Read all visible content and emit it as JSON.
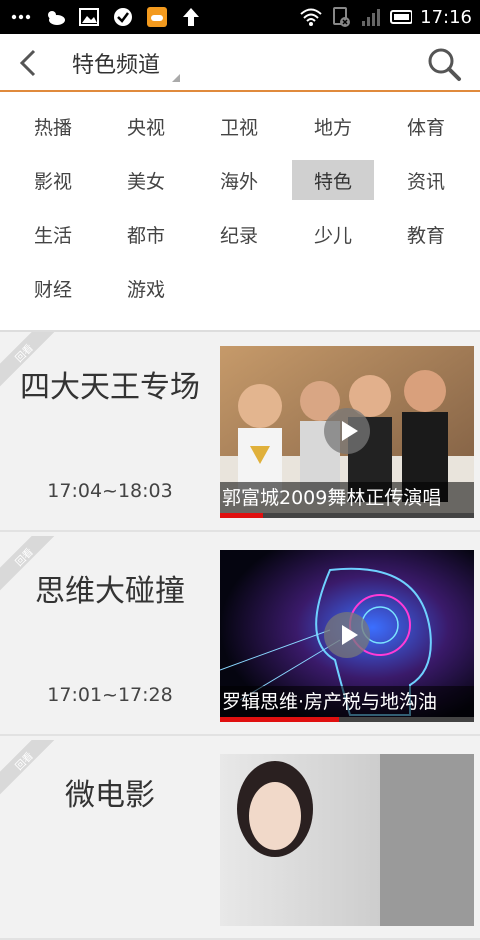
{
  "statusbar": {
    "time": "17:16",
    "left_icons": [
      "more-icon",
      "weather-icon",
      "gallery-icon",
      "check-icon",
      "game-icon",
      "upload-icon"
    ],
    "right_icons": [
      "wifi-icon",
      "sim-icon",
      "signal-icon",
      "battery-icon"
    ]
  },
  "appbar": {
    "title": "特色频道"
  },
  "categories": [
    {
      "label": "热播",
      "selected": false
    },
    {
      "label": "央视",
      "selected": false
    },
    {
      "label": "卫视",
      "selected": false
    },
    {
      "label": "地方",
      "selected": false
    },
    {
      "label": "体育",
      "selected": false
    },
    {
      "label": "影视",
      "selected": false
    },
    {
      "label": "美女",
      "selected": false
    },
    {
      "label": "海外",
      "selected": false
    },
    {
      "label": "特色",
      "selected": true
    },
    {
      "label": "资讯",
      "selected": false
    },
    {
      "label": "生活",
      "selected": false
    },
    {
      "label": "都市",
      "selected": false
    },
    {
      "label": "纪录",
      "selected": false
    },
    {
      "label": "少儿",
      "selected": false
    },
    {
      "label": "教育",
      "selected": false
    },
    {
      "label": "财经",
      "selected": false
    },
    {
      "label": "游戏",
      "selected": false
    }
  ],
  "programs": [
    {
      "badge": "回看",
      "name": "四大天王专场",
      "time": "17:04~18:03",
      "caption": "郭富城2009舞林正传演唱",
      "progress": 0.17
    },
    {
      "badge": "回看",
      "name": "思维大碰撞",
      "time": "17:01~17:28",
      "caption": "罗辑思维·房产税与地沟油",
      "progress": 0.47
    },
    {
      "badge": "回看",
      "name": "微电影",
      "time": "",
      "caption": "",
      "progress": 0
    }
  ],
  "colors": {
    "accent": "#e08a3c",
    "selected_bg": "#d0d0d0",
    "progress": "#e01010"
  }
}
